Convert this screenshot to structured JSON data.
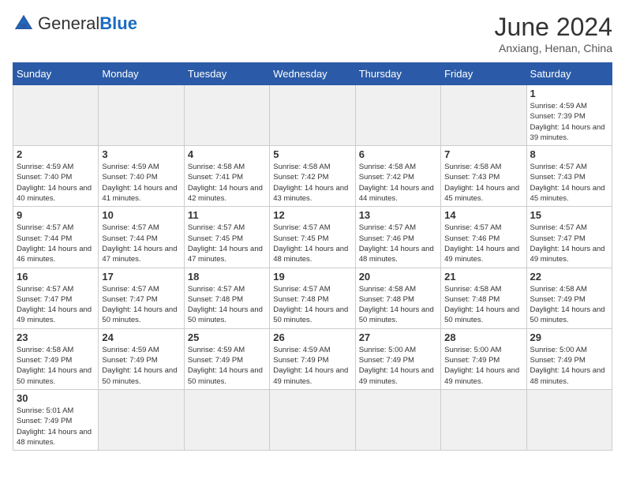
{
  "header": {
    "logo_general": "General",
    "logo_blue": "Blue",
    "title": "June 2024",
    "subtitle": "Anxiang, Henan, China"
  },
  "calendar": {
    "days_of_week": [
      "Sunday",
      "Monday",
      "Tuesday",
      "Wednesday",
      "Thursday",
      "Friday",
      "Saturday"
    ],
    "weeks": [
      [
        {
          "day": "",
          "info": ""
        },
        {
          "day": "",
          "info": ""
        },
        {
          "day": "",
          "info": ""
        },
        {
          "day": "",
          "info": ""
        },
        {
          "day": "",
          "info": ""
        },
        {
          "day": "",
          "info": ""
        },
        {
          "day": "1",
          "info": "Sunrise: 4:59 AM\nSunset: 7:39 PM\nDaylight: 14 hours and 39 minutes."
        }
      ],
      [
        {
          "day": "2",
          "info": "Sunrise: 4:59 AM\nSunset: 7:40 PM\nDaylight: 14 hours and 40 minutes."
        },
        {
          "day": "3",
          "info": "Sunrise: 4:59 AM\nSunset: 7:40 PM\nDaylight: 14 hours and 41 minutes."
        },
        {
          "day": "4",
          "info": "Sunrise: 4:58 AM\nSunset: 7:41 PM\nDaylight: 14 hours and 42 minutes."
        },
        {
          "day": "5",
          "info": "Sunrise: 4:58 AM\nSunset: 7:42 PM\nDaylight: 14 hours and 43 minutes."
        },
        {
          "day": "6",
          "info": "Sunrise: 4:58 AM\nSunset: 7:42 PM\nDaylight: 14 hours and 44 minutes."
        },
        {
          "day": "7",
          "info": "Sunrise: 4:58 AM\nSunset: 7:43 PM\nDaylight: 14 hours and 45 minutes."
        },
        {
          "day": "8",
          "info": "Sunrise: 4:57 AM\nSunset: 7:43 PM\nDaylight: 14 hours and 45 minutes."
        }
      ],
      [
        {
          "day": "9",
          "info": "Sunrise: 4:57 AM\nSunset: 7:44 PM\nDaylight: 14 hours and 46 minutes."
        },
        {
          "day": "10",
          "info": "Sunrise: 4:57 AM\nSunset: 7:44 PM\nDaylight: 14 hours and 47 minutes."
        },
        {
          "day": "11",
          "info": "Sunrise: 4:57 AM\nSunset: 7:45 PM\nDaylight: 14 hours and 47 minutes."
        },
        {
          "day": "12",
          "info": "Sunrise: 4:57 AM\nSunset: 7:45 PM\nDaylight: 14 hours and 48 minutes."
        },
        {
          "day": "13",
          "info": "Sunrise: 4:57 AM\nSunset: 7:46 PM\nDaylight: 14 hours and 48 minutes."
        },
        {
          "day": "14",
          "info": "Sunrise: 4:57 AM\nSunset: 7:46 PM\nDaylight: 14 hours and 49 minutes."
        },
        {
          "day": "15",
          "info": "Sunrise: 4:57 AM\nSunset: 7:47 PM\nDaylight: 14 hours and 49 minutes."
        }
      ],
      [
        {
          "day": "16",
          "info": "Sunrise: 4:57 AM\nSunset: 7:47 PM\nDaylight: 14 hours and 49 minutes."
        },
        {
          "day": "17",
          "info": "Sunrise: 4:57 AM\nSunset: 7:47 PM\nDaylight: 14 hours and 50 minutes."
        },
        {
          "day": "18",
          "info": "Sunrise: 4:57 AM\nSunset: 7:48 PM\nDaylight: 14 hours and 50 minutes."
        },
        {
          "day": "19",
          "info": "Sunrise: 4:57 AM\nSunset: 7:48 PM\nDaylight: 14 hours and 50 minutes."
        },
        {
          "day": "20",
          "info": "Sunrise: 4:58 AM\nSunset: 7:48 PM\nDaylight: 14 hours and 50 minutes."
        },
        {
          "day": "21",
          "info": "Sunrise: 4:58 AM\nSunset: 7:48 PM\nDaylight: 14 hours and 50 minutes."
        },
        {
          "day": "22",
          "info": "Sunrise: 4:58 AM\nSunset: 7:49 PM\nDaylight: 14 hours and 50 minutes."
        }
      ],
      [
        {
          "day": "23",
          "info": "Sunrise: 4:58 AM\nSunset: 7:49 PM\nDaylight: 14 hours and 50 minutes."
        },
        {
          "day": "24",
          "info": "Sunrise: 4:59 AM\nSunset: 7:49 PM\nDaylight: 14 hours and 50 minutes."
        },
        {
          "day": "25",
          "info": "Sunrise: 4:59 AM\nSunset: 7:49 PM\nDaylight: 14 hours and 50 minutes."
        },
        {
          "day": "26",
          "info": "Sunrise: 4:59 AM\nSunset: 7:49 PM\nDaylight: 14 hours and 49 minutes."
        },
        {
          "day": "27",
          "info": "Sunrise: 5:00 AM\nSunset: 7:49 PM\nDaylight: 14 hours and 49 minutes."
        },
        {
          "day": "28",
          "info": "Sunrise: 5:00 AM\nSunset: 7:49 PM\nDaylight: 14 hours and 49 minutes."
        },
        {
          "day": "29",
          "info": "Sunrise: 5:00 AM\nSunset: 7:49 PM\nDaylight: 14 hours and 48 minutes."
        }
      ],
      [
        {
          "day": "30",
          "info": "Sunrise: 5:01 AM\nSunset: 7:49 PM\nDaylight: 14 hours and 48 minutes."
        },
        {
          "day": "",
          "info": ""
        },
        {
          "day": "",
          "info": ""
        },
        {
          "day": "",
          "info": ""
        },
        {
          "day": "",
          "info": ""
        },
        {
          "day": "",
          "info": ""
        },
        {
          "day": "",
          "info": ""
        }
      ]
    ]
  }
}
